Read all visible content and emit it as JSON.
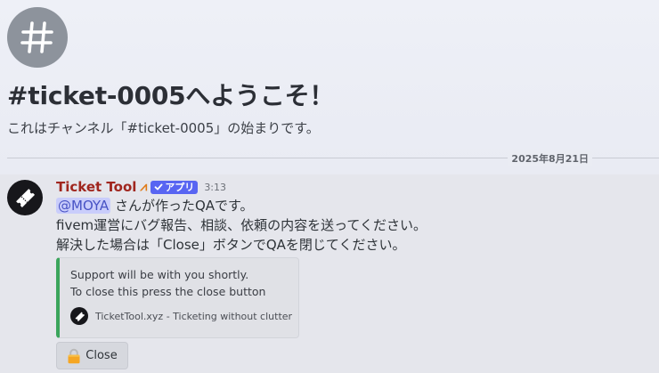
{
  "welcome": {
    "title": "#ticket-0005へようこそ！",
    "subtitle": "これはチャンネル「#ticket-0005」の始まりです。",
    "hash_icon": "hash-icon"
  },
  "divider": {
    "date": "2025年8月21日"
  },
  "message": {
    "author": "Ticket Tool",
    "flair_icon": "⩘",
    "app_badge": "アプリ",
    "time": "3:13",
    "mention": "@MOYA",
    "line1_rest": " さんが作ったQAです。",
    "line2": "fivem運営にバグ報告、相談、依頼の内容を送ってください。",
    "line3": "解決した場合は「Close」ボタンでQAを閉じてください。",
    "avatar_icon": "ticket-icon"
  },
  "embed": {
    "line1": "Support will be with you shortly.",
    "line2": "To close this press the close button",
    "footer": "TicketTool.xyz - Ticketing without clutter",
    "accent_color": "#3ba55c"
  },
  "close_button": {
    "label": "Close",
    "icon": "lock-icon"
  }
}
